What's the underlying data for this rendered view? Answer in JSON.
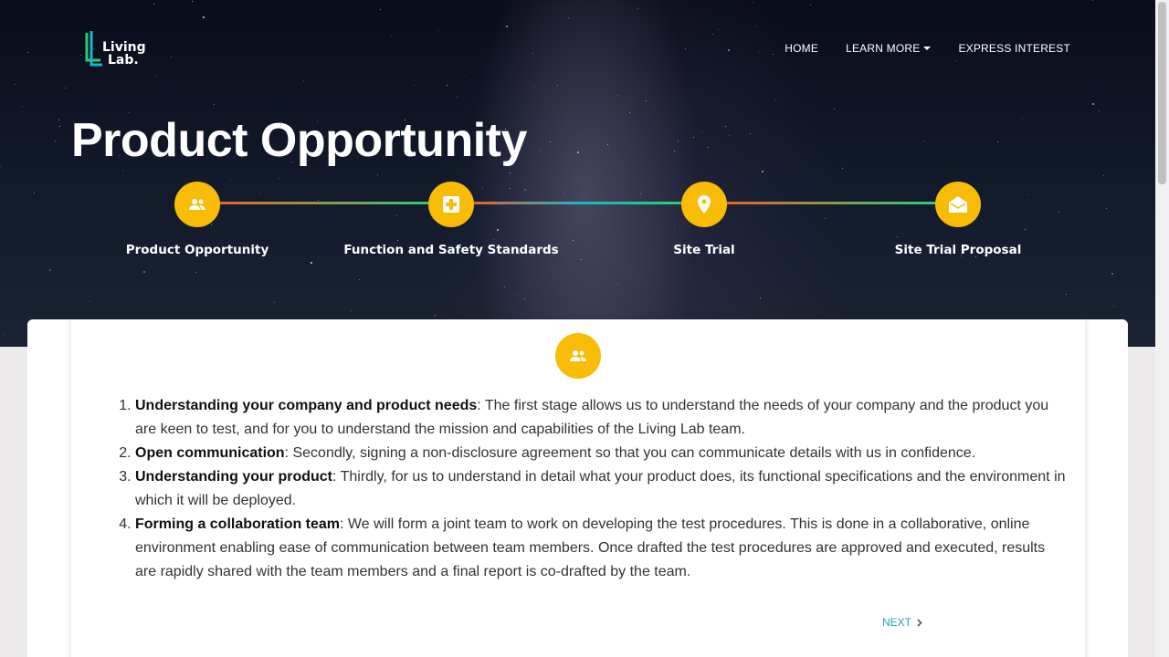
{
  "logo": {
    "line1": "Living",
    "line2": "Lab."
  },
  "nav": {
    "home": "HOME",
    "learn_more": "LEARN MORE",
    "express_interest": "EXPRESS INTEREST"
  },
  "page_title": "Product Opportunity",
  "stepper": {
    "steps": [
      {
        "label": "Product Opportunity",
        "icon": "people-icon"
      },
      {
        "label": "Function and Safety Standards",
        "icon": "medical-plus-icon"
      },
      {
        "label": "Site Trial",
        "icon": "location-pin-icon"
      },
      {
        "label": "Site Trial Proposal",
        "icon": "envelope-open-icon"
      }
    ],
    "accent": "#f8bb06"
  },
  "content": {
    "icon": "people-icon",
    "items": [
      {
        "title": "Understanding your company and product needs",
        "text": ": The first stage allows us to understand the needs of your company and the product you are keen to test, and for you to understand the mission and capabilities of the Living Lab team."
      },
      {
        "title": "Open communication",
        "text": ": Secondly, signing a non-disclosure agreement so that you can communicate details with us in confidence."
      },
      {
        "title": "Understanding your product",
        "text": ": Thirdly, for us to understand in detail what your product does, its functional specifications and the environment in which it will be deployed."
      },
      {
        "title": "Forming a collaboration team",
        "text": ": We will form a joint team to work on developing the test procedures. This is done in a collaborative, online environment enabling ease of communication between team members. Once drafted the test procedures are approved and executed, results are rapidly shared with the team members and a final report is co-drafted by the team."
      }
    ],
    "next_label": "NEXT"
  },
  "colors": {
    "link": "#18a6b8",
    "accent": "#f8bb06"
  }
}
